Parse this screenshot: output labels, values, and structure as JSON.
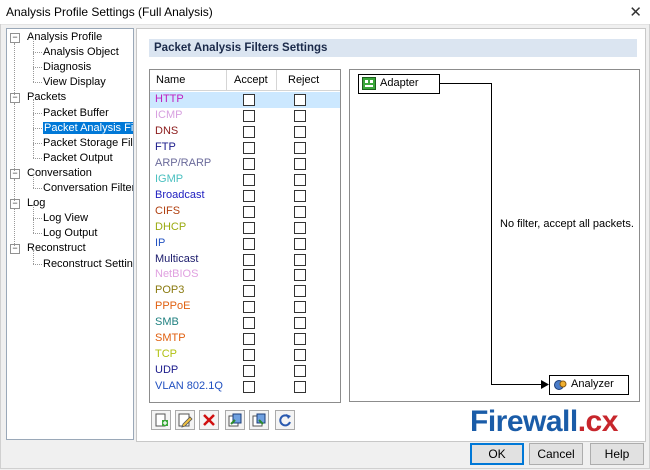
{
  "window": {
    "title": "Analysis Profile Settings (Full Analysis)"
  },
  "tree": [
    {
      "label": "Analysis Profile",
      "level": 0,
      "expander": "−"
    },
    {
      "label": "Analysis Object",
      "level": 1
    },
    {
      "label": "Diagnosis",
      "level": 1
    },
    {
      "label": "View Display",
      "level": 1
    },
    {
      "label": "Packets",
      "level": 0,
      "expander": "−"
    },
    {
      "label": "Packet Buffer",
      "level": 1
    },
    {
      "label": "Packet Analysis Filte",
      "level": 1,
      "selected": true
    },
    {
      "label": "Packet Storage Filte",
      "level": 1
    },
    {
      "label": "Packet Output",
      "level": 1
    },
    {
      "label": "Conversation",
      "level": 0,
      "expander": "−"
    },
    {
      "label": "Conversation Filter",
      "level": 1
    },
    {
      "label": "Log",
      "level": 0,
      "expander": "−"
    },
    {
      "label": "Log View",
      "level": 1
    },
    {
      "label": "Log Output",
      "level": 1
    },
    {
      "label": "Reconstruct",
      "level": 0,
      "expander": "−"
    },
    {
      "label": "Reconstruct Setting",
      "level": 1
    }
  ],
  "panel": {
    "title": "Packet Analysis Filters Settings"
  },
  "filters": {
    "columns": [
      "Name",
      "Accept",
      "Reject"
    ],
    "rows": [
      {
        "name": "HTTP",
        "color": "#c020c0",
        "selected": true
      },
      {
        "name": "ICMP",
        "color": "#d7a0e0"
      },
      {
        "name": "DNS",
        "color": "#8b1a1a"
      },
      {
        "name": "FTP",
        "color": "#1a1a8b"
      },
      {
        "name": "ARP/RARP",
        "color": "#6a6a9a"
      },
      {
        "name": "IGMP",
        "color": "#4ac0c0"
      },
      {
        "name": "Broadcast",
        "color": "#2020c0"
      },
      {
        "name": "CIFS",
        "color": "#b04010"
      },
      {
        "name": "DHCP",
        "color": "#9aaa10"
      },
      {
        "name": "IP",
        "color": "#2050c0"
      },
      {
        "name": "Multicast",
        "color": "#1a1a6b"
      },
      {
        "name": "NetBIOS",
        "color": "#e0a0e0"
      },
      {
        "name": "POP3",
        "color": "#8a7a10"
      },
      {
        "name": "PPPoE",
        "color": "#e06010"
      },
      {
        "name": "SMB",
        "color": "#208080"
      },
      {
        "name": "SMTP",
        "color": "#e06010"
      },
      {
        "name": "TCP",
        "color": "#b0c010"
      },
      {
        "name": "UDP",
        "color": "#1a1a8b"
      },
      {
        "name": "VLAN 802.1Q",
        "color": "#2050c0"
      }
    ]
  },
  "flow": {
    "source": "Adapter",
    "message": "No filter, accept all packets.",
    "target": "Analyzer"
  },
  "toolbar": [
    {
      "name": "new-filter-button",
      "icon": "new-doc-icon"
    },
    {
      "name": "edit-filter-button",
      "icon": "pencil-icon"
    },
    {
      "name": "delete-filter-button",
      "icon": "red-x-icon"
    },
    {
      "name": "import-filter-button",
      "icon": "import-icon"
    },
    {
      "name": "export-filter-button",
      "icon": "export-icon"
    },
    {
      "name": "refresh-button",
      "icon": "refresh-icon"
    }
  ],
  "watermark": {
    "brand": "Firewall",
    "suffix": ".cx"
  },
  "buttons": {
    "ok": "OK",
    "cancel": "Cancel",
    "help": "Help"
  }
}
